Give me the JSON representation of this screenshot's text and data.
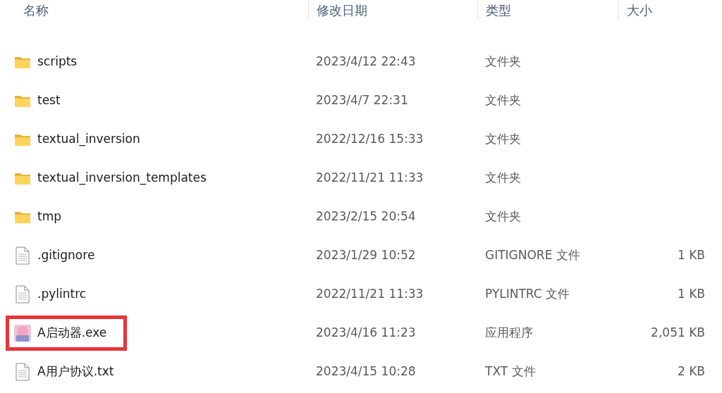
{
  "columns": [
    "名称",
    "修改日期",
    "类型",
    "大小"
  ],
  "rows": [
    {
      "kind": "folder",
      "name": "scripts",
      "date": "2023/4/12 22:43",
      "type": "文件夹",
      "highlighted": false
    },
    {
      "kind": "folder",
      "name": "test",
      "date": "2023/4/7 22:31",
      "type": "文件夹",
      "highlighted": false
    },
    {
      "kind": "folder",
      "name": "textual_inversion",
      "date": "2022/12/16 15:33",
      "type": "文件夹",
      "highlighted": false
    },
    {
      "kind": "folder",
      "name": "textual_inversion_templates",
      "date": "2022/11/21 11:33",
      "type": "文件夹",
      "highlighted": false
    },
    {
      "kind": "folder",
      "name": "tmp",
      "date": "2023/2/15 20:54",
      "type": "文件夹",
      "highlighted": false
    },
    {
      "kind": "file",
      "name": ".gitignore",
      "date": "2023/1/29 10:52",
      "type": "GITIGNORE 文件",
      "size": "1 KB",
      "highlighted": false
    },
    {
      "kind": "file",
      "name": ".pylintrc",
      "date": "2022/11/21 11:33",
      "type": "PYLINTRC 文件",
      "size": "1 KB",
      "highlighted": false
    },
    {
      "kind": "app",
      "name": "A启动器.exe",
      "date": "2023/4/16 11:23",
      "type": "应用程序",
      "size": "2,051 KB",
      "highlighted": true
    },
    {
      "kind": "file",
      "name": "A用户协议.txt",
      "date": "2023/4/15 10:28",
      "type": "TXT 文件",
      "size": "2 KB",
      "highlighted": false
    }
  ]
}
